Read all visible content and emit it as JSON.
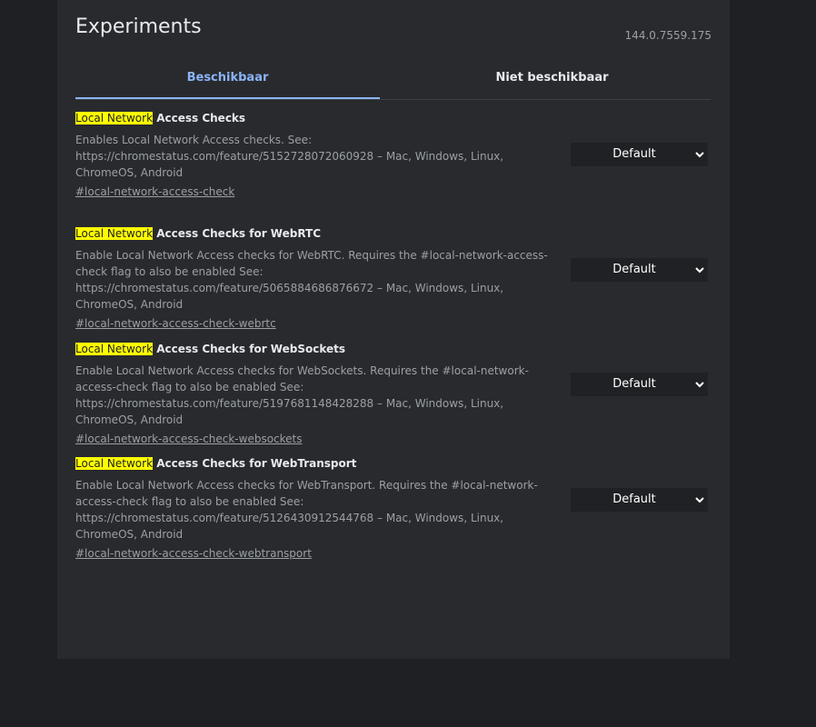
{
  "header": {
    "title": "Experiments",
    "version": "144.0.7559.175"
  },
  "tabs": [
    {
      "label": "Beschikbaar",
      "active": true
    },
    {
      "label": "Niet beschikbaar",
      "active": false
    }
  ],
  "search_highlight": "Local Network",
  "experiments": [
    {
      "highlight": "Local Network",
      "title_rest": " Access Checks",
      "description": "Enables Local Network Access checks. See: https://chromestatus.com/feature/5152728072060928 – Mac, Windows, Linux, ChromeOS, Android",
      "link": "#local-network-access-check",
      "select_value": "Default"
    },
    {
      "highlight": "Local Network",
      "title_rest": " Access Checks for WebRTC",
      "description": "Enable Local Network Access checks for WebRTC. Requires the #local-network-access-check flag to also be enabled See: https://chromestatus.com/feature/5065884686876672 – Mac, Windows, Linux, ChromeOS, Android",
      "link": "#local-network-access-check-webrtc",
      "select_value": "Default"
    },
    {
      "highlight": "Local Network",
      "title_rest": " Access Checks for WebSockets",
      "description": "Enable Local Network Access checks for WebSockets. Requires the #local-network-access-check flag to also be enabled See: https://chromestatus.com/feature/5197681148428288 – Mac, Windows, Linux, ChromeOS, Android",
      "link": "#local-network-access-check-websockets",
      "select_value": "Default"
    },
    {
      "highlight": "Local Network",
      "title_rest": " Access Checks for WebTransport",
      "description": "Enable Local Network Access checks for WebTransport. Requires the #local-network-access-check flag to also be enabled See: https://chromestatus.com/feature/5126430912544768 – Mac, Windows, Linux, ChromeOS, Android",
      "link": "#local-network-access-check-webtransport",
      "select_value": "Default"
    }
  ],
  "colors": {
    "background": "#1f2023",
    "panel": "#292a2d",
    "accent": "#8ab4f8",
    "highlight": "#ffff00"
  }
}
